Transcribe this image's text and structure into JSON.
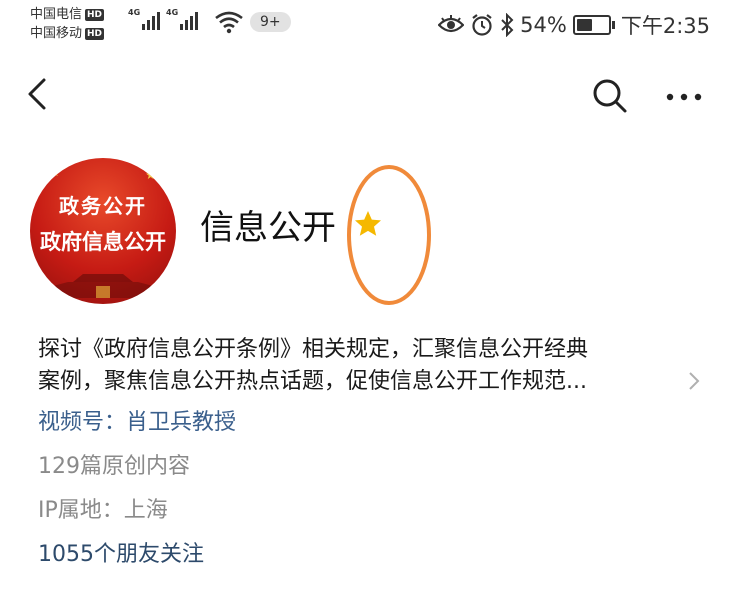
{
  "status_bar": {
    "carrier1": "中国电信",
    "carrier2": "中国移动",
    "hd": "HD",
    "net1": "4G",
    "net2": "4G",
    "notification_badge": "9+",
    "battery_percent": "54%",
    "time": "下午2:35",
    "icons": [
      "eye-icon",
      "alarm-icon",
      "bluetooth-icon",
      "battery-icon",
      "wifi-icon",
      "signal-icon"
    ]
  },
  "nav": {
    "icons": [
      "back-icon",
      "search-icon",
      "more-icon"
    ]
  },
  "profile": {
    "avatar_text_line1": "政务公开",
    "avatar_text_line2": "政府信息公开",
    "name": "信息公开",
    "verified_icon": "star-icon",
    "description_line1": "探讨《政府信息公开条例》相关规定，汇聚信息公开经典",
    "description_line2": "案例，聚焦信息公开热点话题，促使信息公开工作规范...",
    "channel": "视频号：肖卫兵教授",
    "article_count": "129篇原创内容",
    "ip_location": "IP属地：上海",
    "followers": "1055个朋友关注"
  },
  "colors": {
    "annotation_circle": "#f08a3a",
    "star": "#f5b800",
    "link_blue": "#3a5f8c",
    "muted_gray": "#8a8a8a"
  }
}
